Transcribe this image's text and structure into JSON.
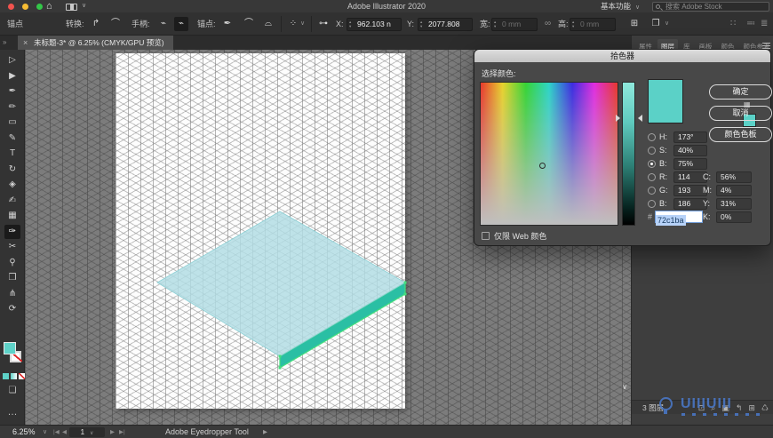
{
  "titlebar": {
    "app_title": "Adobe Illustrator 2020",
    "workspace": "基本功能",
    "workspace_chevron": "∨",
    "search_placeholder": "搜索 Adobe Stock",
    "home_glyph": "⌂"
  },
  "controlbar": {
    "anchor_label": "锚点",
    "convert_label": "转换:",
    "handles_label": "手柄:",
    "anchor2_label": "锚点:",
    "x_label": "X:",
    "x_value": "962.103 n",
    "y_label": "Y:",
    "y_value": "2077.808",
    "w_label": "宽:",
    "w_value": "0 mm",
    "h_label": "高:",
    "h_value": "0 mm",
    "icons": {
      "convert_corner": "↱",
      "convert_smooth": "⌒",
      "handles_show": "⌁",
      "handles_hide": "⌁",
      "anchor_add": "✒",
      "anchor_curve1": "⌒",
      "anchor_curve2": "⌓",
      "align_grid": "⁘",
      "chevron": "∨",
      "anchor_point": "⊶",
      "link": "∞",
      "transform": "⊞",
      "shape_props": "❐",
      "right1": "∷",
      "right2": "≕",
      "right3": "≣"
    }
  },
  "tabbar": {
    "overflow_chevron": "»",
    "close": "×",
    "tab_title": "未标题-3* @ 6.25% (CMYK/GPU 预览)"
  },
  "toolbar": {
    "tools": [
      {
        "name": "selection-tool",
        "glyph": "▷",
        "active": false
      },
      {
        "name": "direct-selection-tool",
        "glyph": "▶",
        "active": false
      },
      {
        "name": "pen-tool",
        "glyph": "✒",
        "active": false
      },
      {
        "name": "curvature-tool",
        "glyph": "✏",
        "active": false
      },
      {
        "name": "rectangle-tool",
        "glyph": "▭",
        "active": false
      },
      {
        "name": "paintbrush-tool",
        "glyph": "✎",
        "active": false
      },
      {
        "name": "type-tool",
        "glyph": "T",
        "active": false
      },
      {
        "name": "rotate-tool",
        "glyph": "↻",
        "active": false
      },
      {
        "name": "eraser-tool",
        "glyph": "◈",
        "active": false
      },
      {
        "name": "shaper-tool",
        "glyph": "✍",
        "active": false
      },
      {
        "name": "gradient-tool",
        "glyph": "▦",
        "active": false
      },
      {
        "name": "eyedropper-tool",
        "glyph": "✑",
        "active": true
      },
      {
        "name": "scissors-tool",
        "glyph": "✂",
        "active": false
      },
      {
        "name": "zoom-tool",
        "glyph": "⚲",
        "active": false
      },
      {
        "name": "artboard-tool",
        "glyph": "❒",
        "active": false
      },
      {
        "name": "shear-tool",
        "glyph": "⋔",
        "active": false
      },
      {
        "name": "rotate-view-tool",
        "glyph": "⟳",
        "active": false
      }
    ],
    "fill_color": "#5ed2c8",
    "mini_swatch_color": "#5ed2c8",
    "draw_mode_glyph": "❏",
    "more_glyph": "…"
  },
  "canvas": {
    "top_face_fill": "rgba(178,221,228,0.84)",
    "top_face_stroke": "#8ccfd4",
    "side_fill": "#2abfa4",
    "side_stroke": "#45df7d",
    "scroll_chevron": "∨"
  },
  "color_picker": {
    "title": "拾色器",
    "select_label": "选择颜色:",
    "buttons": {
      "ok": "确定",
      "cancel": "取消",
      "swatches": "颜色色板"
    },
    "rows": [
      {
        "label": "H:",
        "value": "173°",
        "selected": false
      },
      {
        "label": "S:",
        "value": "40%",
        "selected": false
      },
      {
        "label": "B:",
        "value": "75%",
        "selected": true
      },
      {
        "label": "R:",
        "value": "114",
        "selected": false
      },
      {
        "label": "G:",
        "value": "193",
        "selected": false
      },
      {
        "label": "B:",
        "value": "186",
        "selected": false
      }
    ],
    "cmyk": [
      {
        "label": "C:",
        "value": "56%"
      },
      {
        "label": "M:",
        "value": "4%"
      },
      {
        "label": "Y:",
        "value": "31%"
      },
      {
        "label": "K:",
        "value": "0%"
      }
    ],
    "hex_hash": "#",
    "hex_value": "72c1ba",
    "web_only_label": "仅限 Web 颜色",
    "new_color": "#5bd1c7",
    "cube_glyph": "▦"
  },
  "panel": {
    "tabs": [
      {
        "label": "属性",
        "active": false
      },
      {
        "label": "图层",
        "active": true
      },
      {
        "label": "库",
        "active": false
      },
      {
        "label": "画板",
        "active": false
      },
      {
        "label": "颜色",
        "active": false
      },
      {
        "label": "颜色参考",
        "active": false
      }
    ],
    "footer": {
      "count": "3 图层",
      "icons": [
        {
          "name": "locate-object-icon",
          "glyph": "⊡"
        },
        {
          "name": "search-icon",
          "glyph": "⌕"
        },
        {
          "name": "clipping-mask-icon",
          "glyph": "▣"
        },
        {
          "name": "new-sublayer-icon",
          "glyph": "↰"
        },
        {
          "name": "new-layer-icon",
          "glyph": "⊞"
        },
        {
          "name": "delete-layer-icon",
          "glyph": "♺"
        }
      ]
    }
  },
  "statusbar": {
    "zoom_value": "6.25%",
    "zoom_chevron": "∨",
    "nav_first": "|◀",
    "nav_prev": "◀",
    "artboard_number": "1",
    "nav_next": "▶",
    "nav_last": "▶|",
    "tool_name": "Adobe Eyedropper Tool",
    "arrow": "▶"
  },
  "watermark": {
    "brand": "UIIIUIII"
  }
}
